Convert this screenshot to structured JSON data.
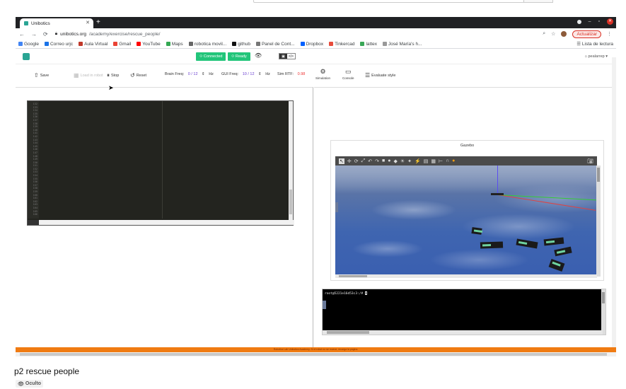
{
  "browser": {
    "tab_title": "Unibotics",
    "url_host": "unibotics.org",
    "url_path": "/academy/exercise/rescue_people/",
    "update_label": "Actualizar",
    "reading_list": "Lista de lectura"
  },
  "bookmarks": [
    {
      "label": "Google",
      "color": "#4285f4"
    },
    {
      "label": "Correo urjc",
      "color": "#1a73e8"
    },
    {
      "label": "Aula Virtual",
      "color": "#c0392b"
    },
    {
      "label": "Gmail",
      "color": "#ea4335"
    },
    {
      "label": "YouTube",
      "color": "#ff0000"
    },
    {
      "label": "Maps",
      "color": "#34a853"
    },
    {
      "label": "robotica movil...",
      "color": "#666"
    },
    {
      "label": "github",
      "color": "#111"
    },
    {
      "label": "Panel de Cont...",
      "color": "#777"
    },
    {
      "label": "Dropbox",
      "color": "#0061ff"
    },
    {
      "label": "Tinkercad",
      "color": "#e74c3c"
    },
    {
      "label": "lattex",
      "color": "#3aa757"
    },
    {
      "label": "José María's h...",
      "color": "#999"
    }
  ],
  "appbar": {
    "connected_label": "Connected",
    "ready_label": "Ready",
    "view_left": "▣",
    "view_right": "</>",
    "user_label": "pealarrep"
  },
  "toolbar": {
    "save_label": "Save",
    "load_label": "Load in robot",
    "stop_label": "Stop",
    "reset_label": "Reset",
    "brain_freq_label": "Brain Freq:",
    "brain_freq_value": "0 / 12",
    "brain_freq_unit": "Hz",
    "gui_freq_label": "GUI Freq:",
    "gui_freq_value": "10 / 12",
    "gui_freq_unit": "Hz",
    "sim_rtf_label": "Sim RTF:",
    "sim_rtf_value": "0.98",
    "simulation_label": "Simulation",
    "console_label": "Console",
    "evaluate_label": "Evaluate style"
  },
  "editor": {
    "line_numbers": [
      "132",
      "133",
      "134",
      "135",
      "136",
      "137",
      "138",
      "139",
      "140",
      "141",
      "142",
      "143",
      "144",
      "145",
      "146",
      "147",
      "148",
      "149",
      "150",
      "151",
      "152",
      "153",
      "154",
      "155",
      "156",
      "157",
      "158",
      "159",
      "160",
      "161",
      "162",
      "163",
      "164",
      "165",
      "166"
    ]
  },
  "gazebo": {
    "title": "Gazebo",
    "tools": [
      "↖",
      "✛",
      "⟳",
      "⤢",
      "↶",
      "↷",
      "■",
      "●",
      "◆",
      "☀",
      "✦",
      "⚡",
      "▤",
      "▦",
      "⊢",
      "∩",
      "●"
    ]
  },
  "console": {
    "prompt": "root@5221e16d53c3:/# "
  },
  "footer_bar": "Robotics Lab Unibotics Academy. Si el robot no se mueve, recarga la página.",
  "page": {
    "title": "p2 rescue people",
    "visibility": "Oculto"
  }
}
